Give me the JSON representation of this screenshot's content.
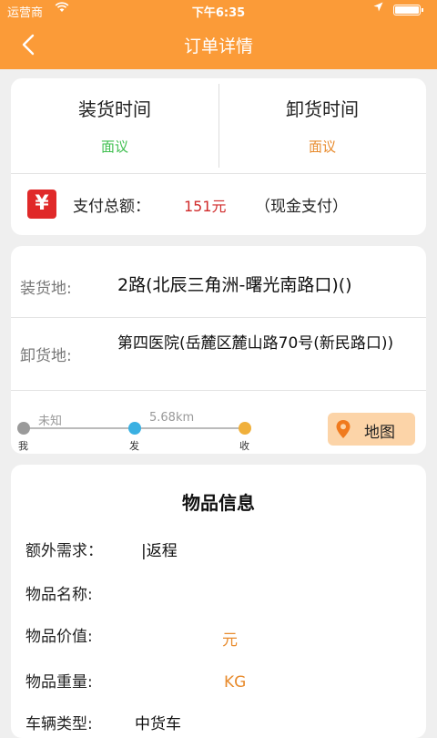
{
  "status_bar": {
    "carrier": "运营商",
    "time": "下午6:35"
  },
  "nav": {
    "title": "订单详情",
    "back_icon": "chevron-left-icon"
  },
  "times": {
    "load": {
      "label": "装货时间",
      "value": "面议",
      "color": "#3fbf4f"
    },
    "unload": {
      "label": "卸货时间",
      "value": "面议",
      "color": "#e88b2d"
    }
  },
  "payment": {
    "icon": "yen-icon",
    "icon_glyph": "¥",
    "label": "支付总额：",
    "amount": "151元",
    "method": "（现金支付）"
  },
  "addresses": {
    "load": {
      "label": "装货地:",
      "value": "2路(北辰三角洲-曙光南路口)()"
    },
    "unload": {
      "label": "卸货地:",
      "value": "第四医院(岳麓区麓山路70号(新民路口))"
    }
  },
  "route": {
    "seg1_status": "未知",
    "seg2_distance": "5.68km",
    "points": [
      {
        "label": "我",
        "color": "#9a9a9a"
      },
      {
        "label": "发",
        "color": "#3ab0e2"
      },
      {
        "label": "收",
        "color": "#f0b03c"
      }
    ],
    "map_button": "地图"
  },
  "goods": {
    "title": "物品信息",
    "rows": [
      {
        "label": "额外需求：",
        "value": "|返程"
      },
      {
        "label": "物品名称:",
        "value": ""
      },
      {
        "label": "物品价值:",
        "value": "元"
      },
      {
        "label": "物品重量:",
        "value": "KG"
      },
      {
        "label": "车辆类型:",
        "value": "中货车"
      }
    ]
  }
}
